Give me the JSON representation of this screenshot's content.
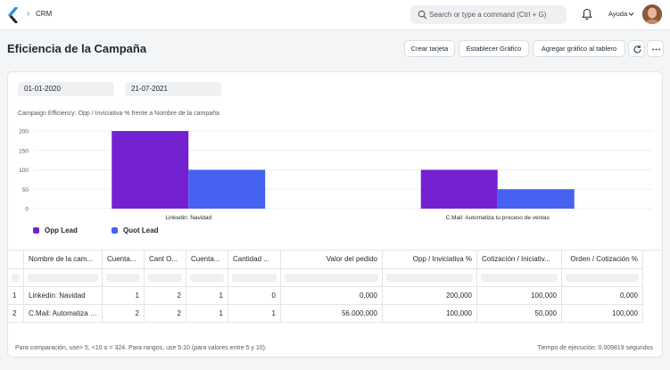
{
  "navbar": {
    "breadcrumb": "CRM",
    "search_placeholder": "Search or type a command (Ctrl + G)",
    "help_label": "Ayuda"
  },
  "page": {
    "title": "Eficiencia de la Campaña",
    "buttons": {
      "new_card": "Crear tarjeta",
      "set_chart": "Establecer Gráfico",
      "add_to_dashboard": "Agregar gráfico al tablero"
    }
  },
  "filters": {
    "from_date": "01-01-2020",
    "to_date": "21-07-2021"
  },
  "chart_data": {
    "type": "bar",
    "title": "Campaign Efficiency: Opp / Inviciativa % frente a Nombre de la campaña",
    "categories": [
      "Linkedin: Navidad",
      "C.Mail: Automatiza tu proceso de ventas"
    ],
    "series": [
      {
        "name": "Opp Lead",
        "values": [
          200,
          100
        ],
        "color": "#7421d2"
      },
      {
        "name": "Quot Lead",
        "values": [
          100,
          50
        ],
        "color": "#4563f0"
      }
    ],
    "yticks": [
      0,
      50,
      100,
      150,
      200
    ],
    "ylim": [
      0,
      200
    ],
    "grid": true,
    "legend": "bottom-left"
  },
  "table": {
    "columns": [
      "Nombre de la cam...",
      "Cuenta...",
      "Cant O...",
      "Cuenta...",
      "Cantidad ...",
      "Valor del pedido",
      "Opp / Inviciativa %",
      "Cotización / Iniciativ...",
      "Orden / Cotización %"
    ],
    "rows": [
      {
        "index": "1",
        "cells": [
          "Linkedin: Navidad",
          "1",
          "2",
          "1",
          "0",
          "0,000",
          "200,000",
          "100,000",
          "0,000"
        ]
      },
      {
        "index": "2",
        "cells": [
          "C.Mail: Automatiza t...",
          "2",
          "2",
          "1",
          "1",
          "56.000,000",
          "100,000",
          "50,000",
          "100,000"
        ]
      }
    ]
  },
  "footer": {
    "hint": "Para comparación, use> 5, <10 o = 324. Para rangos, use 5:10 (para valores entre 5 y 10).",
    "execution_time": "Tiempo de ejecución: 0.009819 segundos"
  }
}
